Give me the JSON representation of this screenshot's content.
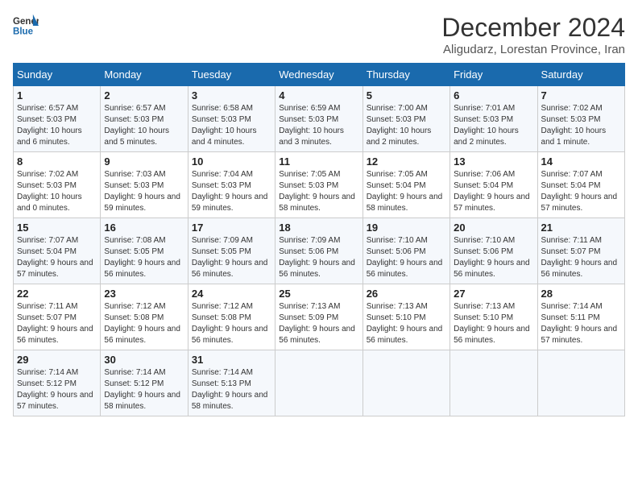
{
  "header": {
    "logo_general": "General",
    "logo_blue": "Blue",
    "month_title": "December 2024",
    "subtitle": "Aligudarz, Lorestan Province, Iran"
  },
  "weekdays": [
    "Sunday",
    "Monday",
    "Tuesday",
    "Wednesday",
    "Thursday",
    "Friday",
    "Saturday"
  ],
  "weeks": [
    [
      {
        "day": "1",
        "sunrise": "6:57 AM",
        "sunset": "5:03 PM",
        "daylight": "10 hours and 6 minutes."
      },
      {
        "day": "2",
        "sunrise": "6:57 AM",
        "sunset": "5:03 PM",
        "daylight": "10 hours and 5 minutes."
      },
      {
        "day": "3",
        "sunrise": "6:58 AM",
        "sunset": "5:03 PM",
        "daylight": "10 hours and 4 minutes."
      },
      {
        "day": "4",
        "sunrise": "6:59 AM",
        "sunset": "5:03 PM",
        "daylight": "10 hours and 3 minutes."
      },
      {
        "day": "5",
        "sunrise": "7:00 AM",
        "sunset": "5:03 PM",
        "daylight": "10 hours and 2 minutes."
      },
      {
        "day": "6",
        "sunrise": "7:01 AM",
        "sunset": "5:03 PM",
        "daylight": "10 hours and 2 minutes."
      },
      {
        "day": "7",
        "sunrise": "7:02 AM",
        "sunset": "5:03 PM",
        "daylight": "10 hours and 1 minute."
      }
    ],
    [
      {
        "day": "8",
        "sunrise": "7:02 AM",
        "sunset": "5:03 PM",
        "daylight": "10 hours and 0 minutes."
      },
      {
        "day": "9",
        "sunrise": "7:03 AM",
        "sunset": "5:03 PM",
        "daylight": "9 hours and 59 minutes."
      },
      {
        "day": "10",
        "sunrise": "7:04 AM",
        "sunset": "5:03 PM",
        "daylight": "9 hours and 59 minutes."
      },
      {
        "day": "11",
        "sunrise": "7:05 AM",
        "sunset": "5:03 PM",
        "daylight": "9 hours and 58 minutes."
      },
      {
        "day": "12",
        "sunrise": "7:05 AM",
        "sunset": "5:04 PM",
        "daylight": "9 hours and 58 minutes."
      },
      {
        "day": "13",
        "sunrise": "7:06 AM",
        "sunset": "5:04 PM",
        "daylight": "9 hours and 57 minutes."
      },
      {
        "day": "14",
        "sunrise": "7:07 AM",
        "sunset": "5:04 PM",
        "daylight": "9 hours and 57 minutes."
      }
    ],
    [
      {
        "day": "15",
        "sunrise": "7:07 AM",
        "sunset": "5:04 PM",
        "daylight": "9 hours and 57 minutes."
      },
      {
        "day": "16",
        "sunrise": "7:08 AM",
        "sunset": "5:05 PM",
        "daylight": "9 hours and 56 minutes."
      },
      {
        "day": "17",
        "sunrise": "7:09 AM",
        "sunset": "5:05 PM",
        "daylight": "9 hours and 56 minutes."
      },
      {
        "day": "18",
        "sunrise": "7:09 AM",
        "sunset": "5:06 PM",
        "daylight": "9 hours and 56 minutes."
      },
      {
        "day": "19",
        "sunrise": "7:10 AM",
        "sunset": "5:06 PM",
        "daylight": "9 hours and 56 minutes."
      },
      {
        "day": "20",
        "sunrise": "7:10 AM",
        "sunset": "5:06 PM",
        "daylight": "9 hours and 56 minutes."
      },
      {
        "day": "21",
        "sunrise": "7:11 AM",
        "sunset": "5:07 PM",
        "daylight": "9 hours and 56 minutes."
      }
    ],
    [
      {
        "day": "22",
        "sunrise": "7:11 AM",
        "sunset": "5:07 PM",
        "daylight": "9 hours and 56 minutes."
      },
      {
        "day": "23",
        "sunrise": "7:12 AM",
        "sunset": "5:08 PM",
        "daylight": "9 hours and 56 minutes."
      },
      {
        "day": "24",
        "sunrise": "7:12 AM",
        "sunset": "5:08 PM",
        "daylight": "9 hours and 56 minutes."
      },
      {
        "day": "25",
        "sunrise": "7:13 AM",
        "sunset": "5:09 PM",
        "daylight": "9 hours and 56 minutes."
      },
      {
        "day": "26",
        "sunrise": "7:13 AM",
        "sunset": "5:10 PM",
        "daylight": "9 hours and 56 minutes."
      },
      {
        "day": "27",
        "sunrise": "7:13 AM",
        "sunset": "5:10 PM",
        "daylight": "9 hours and 56 minutes."
      },
      {
        "day": "28",
        "sunrise": "7:14 AM",
        "sunset": "5:11 PM",
        "daylight": "9 hours and 57 minutes."
      }
    ],
    [
      {
        "day": "29",
        "sunrise": "7:14 AM",
        "sunset": "5:12 PM",
        "daylight": "9 hours and 57 minutes."
      },
      {
        "day": "30",
        "sunrise": "7:14 AM",
        "sunset": "5:12 PM",
        "daylight": "9 hours and 58 minutes."
      },
      {
        "day": "31",
        "sunrise": "7:14 AM",
        "sunset": "5:13 PM",
        "daylight": "9 hours and 58 minutes."
      },
      null,
      null,
      null,
      null
    ]
  ],
  "labels": {
    "sunrise": "Sunrise:",
    "sunset": "Sunset:",
    "daylight": "Daylight:"
  }
}
